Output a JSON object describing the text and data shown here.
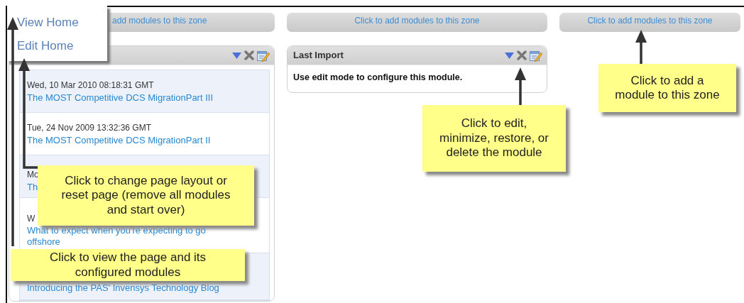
{
  "zones": [
    {
      "add_label": "add modules to this zone",
      "modules": [
        {
          "items": [
            {
              "date": "Wed, 10 Mar 2010 08:18:31 GMT",
              "title": "The MOST Competitive DCS MigrationPart III"
            },
            {
              "date": "Tue, 24 Nov 2009 13:32:36 GMT",
              "title": "The MOST Competitive DCS MigrationPart II"
            },
            {
              "date": "Mo",
              "title": "Th"
            },
            {
              "date": "W",
              "title": "What to expect when you're expecting to go offshore"
            },
            {
              "title": "Introducing the PAS' Invensys Technology Blog"
            }
          ]
        }
      ]
    },
    {
      "add_label": "Click to add modules to this zone",
      "modules": [
        {
          "title": "Last Import",
          "body": "Use edit mode to configure this module."
        }
      ]
    },
    {
      "add_label": "Click to add modules to this zone"
    }
  ],
  "menu": {
    "items": [
      {
        "label": "View Home"
      },
      {
        "label": "Edit Home"
      }
    ]
  },
  "callouts": [
    {
      "text": "Click to add a module to this zone"
    },
    {
      "text": "Click to edit, minimize, restore, or delete the module"
    },
    {
      "text": "Click to change page layout or reset page (remove all modules and start over)"
    },
    {
      "text": "Click to view the page and its configured modules"
    }
  ]
}
